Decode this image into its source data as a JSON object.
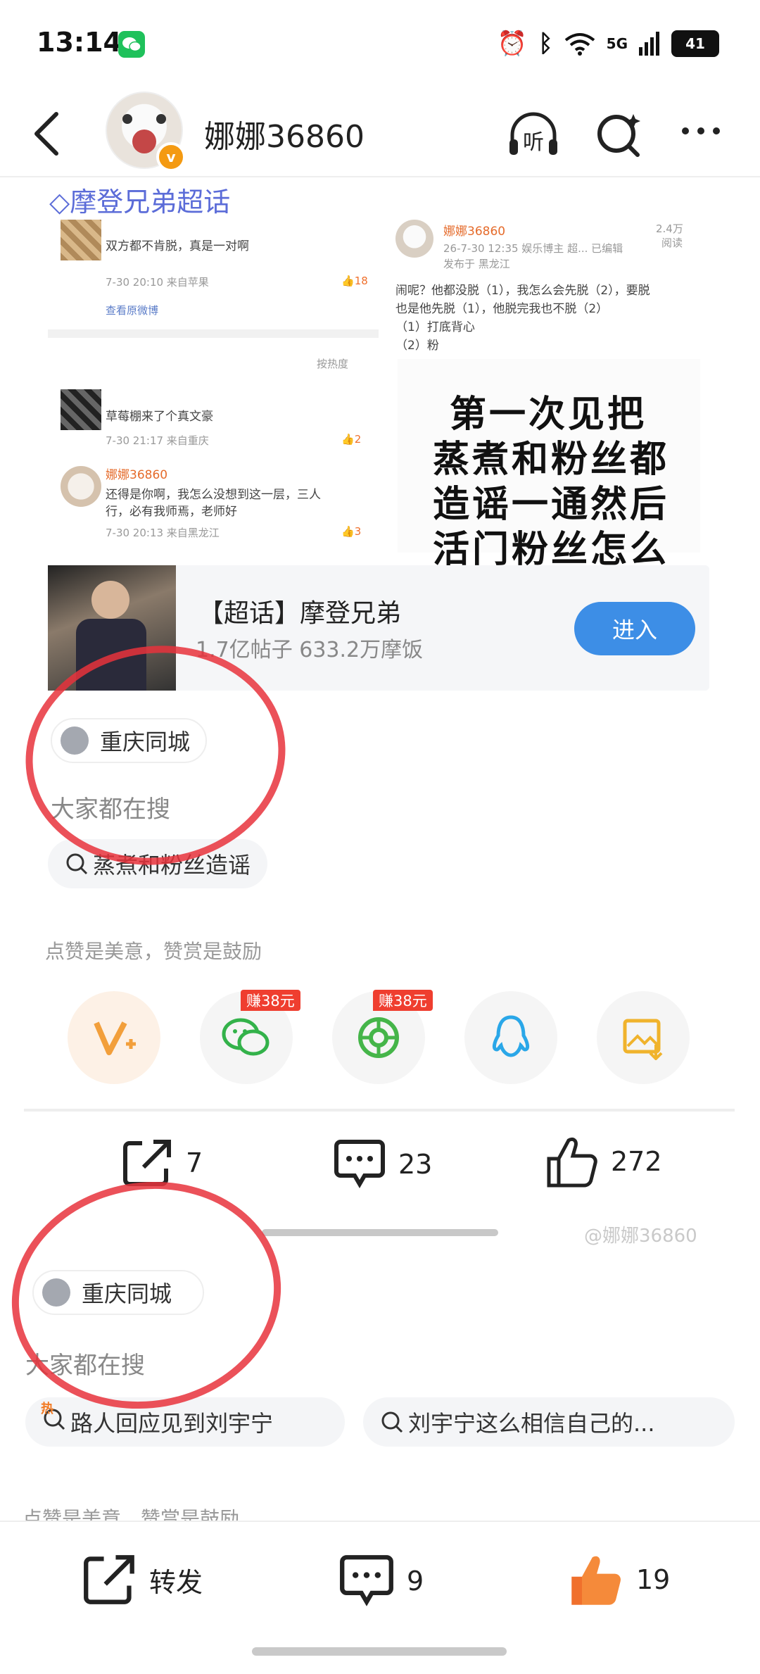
{
  "status": {
    "time": "13:14",
    "battery": "41",
    "network": "5G"
  },
  "header": {
    "username": "娜娜36860",
    "listen_label": "听"
  },
  "embedded": {
    "supertopic_title": "摩登兄弟超话",
    "left_post": {
      "text": "双方都不肯脱，真是一对啊",
      "meta": "7-30 20:10  来自苹果",
      "likes": "18",
      "view_original": "查看原微博"
    },
    "sort_label": "按热度",
    "comment1": {
      "text": "草莓棚来了个真文豪",
      "meta": "7-30 21:17  来自重庆",
      "likes": "2"
    },
    "comment2": {
      "name": "娜娜36860",
      "text1": "还得是你啊，我怎么没想到这一层，三人",
      "text2": "行，必有我师焉，老师好",
      "meta": "7-30 20:13  来自黑龙江",
      "likes": "3"
    },
    "right_post": {
      "name": "娜娜36860",
      "views": "2.4万",
      "views_label": "阅读",
      "meta": "26-7-30 12:35  娱乐博主 超...  已编辑",
      "from": "发布于 黑龙江",
      "text1": "闹呢？他都没脱（1），我怎么会先脱（2），要脱",
      "text2": "也是他先脱（1），他脱完我也不脱（2）",
      "line3": "（1）打底背心",
      "line4": "（2）粉"
    },
    "poster_lines": [
      "第一次见把",
      "蒸煮和粉丝都",
      "造谣一通然后",
      "活门粉丝怎么"
    ]
  },
  "topic_card": {
    "title": "【超话】摩登兄弟",
    "subtitle": "1.7亿帖子 633.2万摩饭",
    "enter": "进入"
  },
  "location1": {
    "label": "重庆同城"
  },
  "search1": {
    "heading": "大家都在搜",
    "query": "蒸煮和粉丝造谣"
  },
  "reward": {
    "label": "点赞是美意，赞赏是鼓励"
  },
  "share": {
    "earn1": "赚38元",
    "earn2": "赚38元"
  },
  "actions1": {
    "repost": "7",
    "comment": "23",
    "like": "272"
  },
  "watermark": "@娜娜36860",
  "location2": {
    "label": "重庆同城"
  },
  "search2": {
    "heading": "大家都在搜",
    "hot_badge": "热",
    "query1": "路人回应见到刘宇宁",
    "query2": "刘宇宁这么相信自己的..."
  },
  "reward2": {
    "label": "点赞是美意，赞赏是鼓励"
  },
  "bottom": {
    "repost_label": "转发",
    "comments": "9",
    "likes": "19"
  },
  "colors": {
    "accent_blue": "#3d8ee6",
    "like_orange": "#f0702c",
    "annotation_red": "#e8323c",
    "topic_purple": "#5b6cd8"
  }
}
